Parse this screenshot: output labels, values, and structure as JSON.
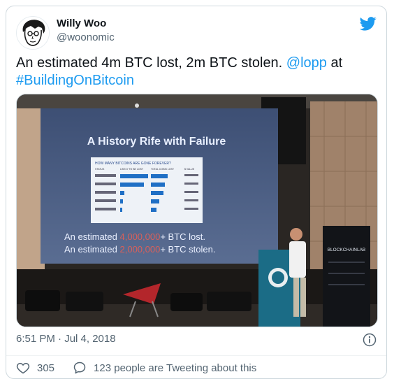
{
  "tweet": {
    "author_name": "Willy Woo",
    "author_handle": "@woonomic",
    "text_part1": "An estimated 4m BTC lost, 2m BTC stolen. ",
    "mention": "@lopp",
    "text_part2": " at ",
    "hashtag": "#BuildingOnBitcoin",
    "timestamp": "6:51 PM · Jul 4, 2018",
    "like_count": "305",
    "tweeting_label": "123 people are Tweeting about this"
  },
  "photo": {
    "slide_title": "A History Rife with Failure",
    "table_title": "HOW MANY BITCOINS ARE GONE FOREVER?",
    "col_status": "STATUS",
    "col_lost": "LIKELY TO BE LOST",
    "col_total": "TOTAL COINS LOST",
    "col_value": "$ VALUE",
    "lost_line_prefix": "An estimated ",
    "lost_line_number": "4,000,000",
    "lost_line_suffix": "+ BTC lost.",
    "stolen_line_prefix": "An estimated ",
    "stolen_line_number": "2,000,000",
    "stolen_line_suffix": "+ BTC stolen.",
    "banner_text": "BLOCKCHAINLAB"
  },
  "colors": {
    "accent": "#1d9bf0",
    "text": "#0f1419",
    "muted": "#536471"
  }
}
